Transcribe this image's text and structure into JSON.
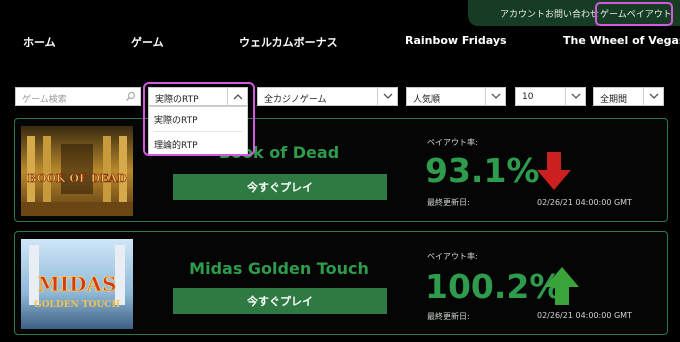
{
  "top_bar": {
    "contact": "アカウントお問い合わせ",
    "payout": "ゲームペイアウト"
  },
  "nav": {
    "home": "ホーム",
    "games": "ゲーム",
    "welcome_bonus": "ウェルカムボーナス",
    "rainbow_fridays": "Rainbow Fridays",
    "wheel_of_vegas": "The Wheel of Vegas"
  },
  "filters": {
    "search_placeholder": "ゲーム検索",
    "rtp_selected": "実際のRTP",
    "category": "全カジノゲーム",
    "sort": "人気順",
    "count": "10",
    "period": "全期間"
  },
  "rtp_dropdown": {
    "options": [
      "実際のRTP",
      "理論的RTP"
    ]
  },
  "games": [
    {
      "title": "Book of Dead",
      "play": "今すぐプレイ",
      "rate_label": "ペイアウト率:",
      "rate": "93.1%",
      "updated_label": "最終更新日:",
      "updated": "02/26/21 04:00:00 GMT",
      "trend": "down",
      "trend_color": "#cc1f1f",
      "thumb_text": "BOOK OF DEAD"
    },
    {
      "title": "Midas Golden Touch",
      "play": "今すぐプレイ",
      "rate_label": "ペイアウト率:",
      "rate": "100.2%",
      "updated_label": "最終更新日:",
      "updated": "02/26/21 04:00:00 GMT",
      "trend": "up",
      "trend_color": "#3aa43a",
      "thumb_text_1": "MIDAS",
      "thumb_text_2": "GOLDEN TOUCH"
    }
  ],
  "colors": {
    "accent_green": "#2f9b4c",
    "button_green": "#2f7a43",
    "highlight": "#d35ae0"
  }
}
